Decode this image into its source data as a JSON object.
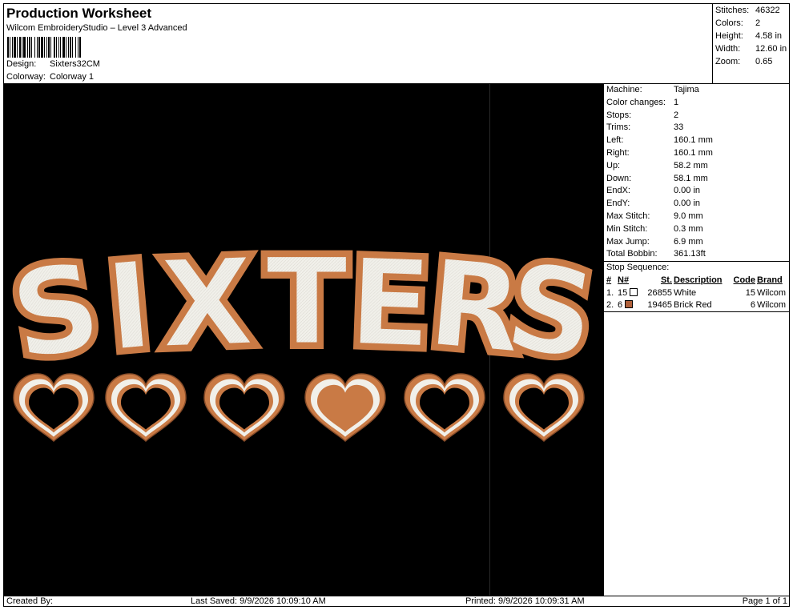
{
  "header": {
    "title": "Production Worksheet",
    "subtitle": "Wilcom EmbroideryStudio – Level 3 Advanced",
    "design_label": "Design:",
    "design_value": "Sixters32CM",
    "colorway_label": "Colorway:",
    "colorway_value": "Colorway 1"
  },
  "summary": [
    {
      "label": "Stitches:",
      "value": "46322"
    },
    {
      "label": "Colors:",
      "value": "2"
    },
    {
      "label": "Height:",
      "value": "4.58 in"
    },
    {
      "label": "Width:",
      "value": "12.60 in"
    },
    {
      "label": "Zoom:",
      "value": "0.65"
    }
  ],
  "design": {
    "text": "SIXTERS",
    "colors": {
      "background": "#000000",
      "fill": "#f1f0ea",
      "outline": "#c97a45",
      "outline_dark": "#8a4e2a"
    },
    "hearts": [
      {
        "filled": false
      },
      {
        "filled": false
      },
      {
        "filled": false
      },
      {
        "filled": true
      },
      {
        "filled": false
      },
      {
        "filled": false
      }
    ]
  },
  "machine_info": [
    {
      "label": "Machine:",
      "value": "Tajima"
    },
    {
      "label": "Color changes:",
      "value": "1"
    },
    {
      "label": "Stops:",
      "value": "2"
    },
    {
      "label": "Trims:",
      "value": "33"
    },
    {
      "label": "Left:",
      "value": "160.1 mm"
    },
    {
      "label": "Right:",
      "value": "160.1 mm"
    },
    {
      "label": "Up:",
      "value": "58.2 mm"
    },
    {
      "label": "Down:",
      "value": "58.1 mm"
    },
    {
      "label": "EndX:",
      "value": "0.00 in"
    },
    {
      "label": "EndY:",
      "value": "0.00 in"
    },
    {
      "label": "Max Stitch:",
      "value": "9.0 mm"
    },
    {
      "label": "Min Stitch:",
      "value": "0.3 mm"
    },
    {
      "label": "Max Jump:",
      "value": "6.9 mm"
    },
    {
      "label": "Total Bobbin:",
      "value": "361.13ft"
    }
  ],
  "stop_sequence": {
    "label": "Stop Sequence:",
    "headers": [
      "#",
      "N#",
      "St.",
      "Description",
      "Code",
      "Brand"
    ],
    "rows": [
      {
        "num": "1.",
        "n": "15",
        "color": "#ffffff",
        "st": "26855",
        "desc": "White",
        "code": "15",
        "brand": "Wilcom"
      },
      {
        "num": "2.",
        "n": "6",
        "color": "#b0603a",
        "st": "19465",
        "desc": "Brick Red",
        "code": "6",
        "brand": "Wilcom"
      }
    ]
  },
  "footer": {
    "created": "Created By:",
    "last_saved": "Last Saved: 9/9/2026 10:09:10 AM",
    "printed": "Printed: 9/9/2026 10:09:31 AM",
    "page": "Page 1 of 1"
  }
}
